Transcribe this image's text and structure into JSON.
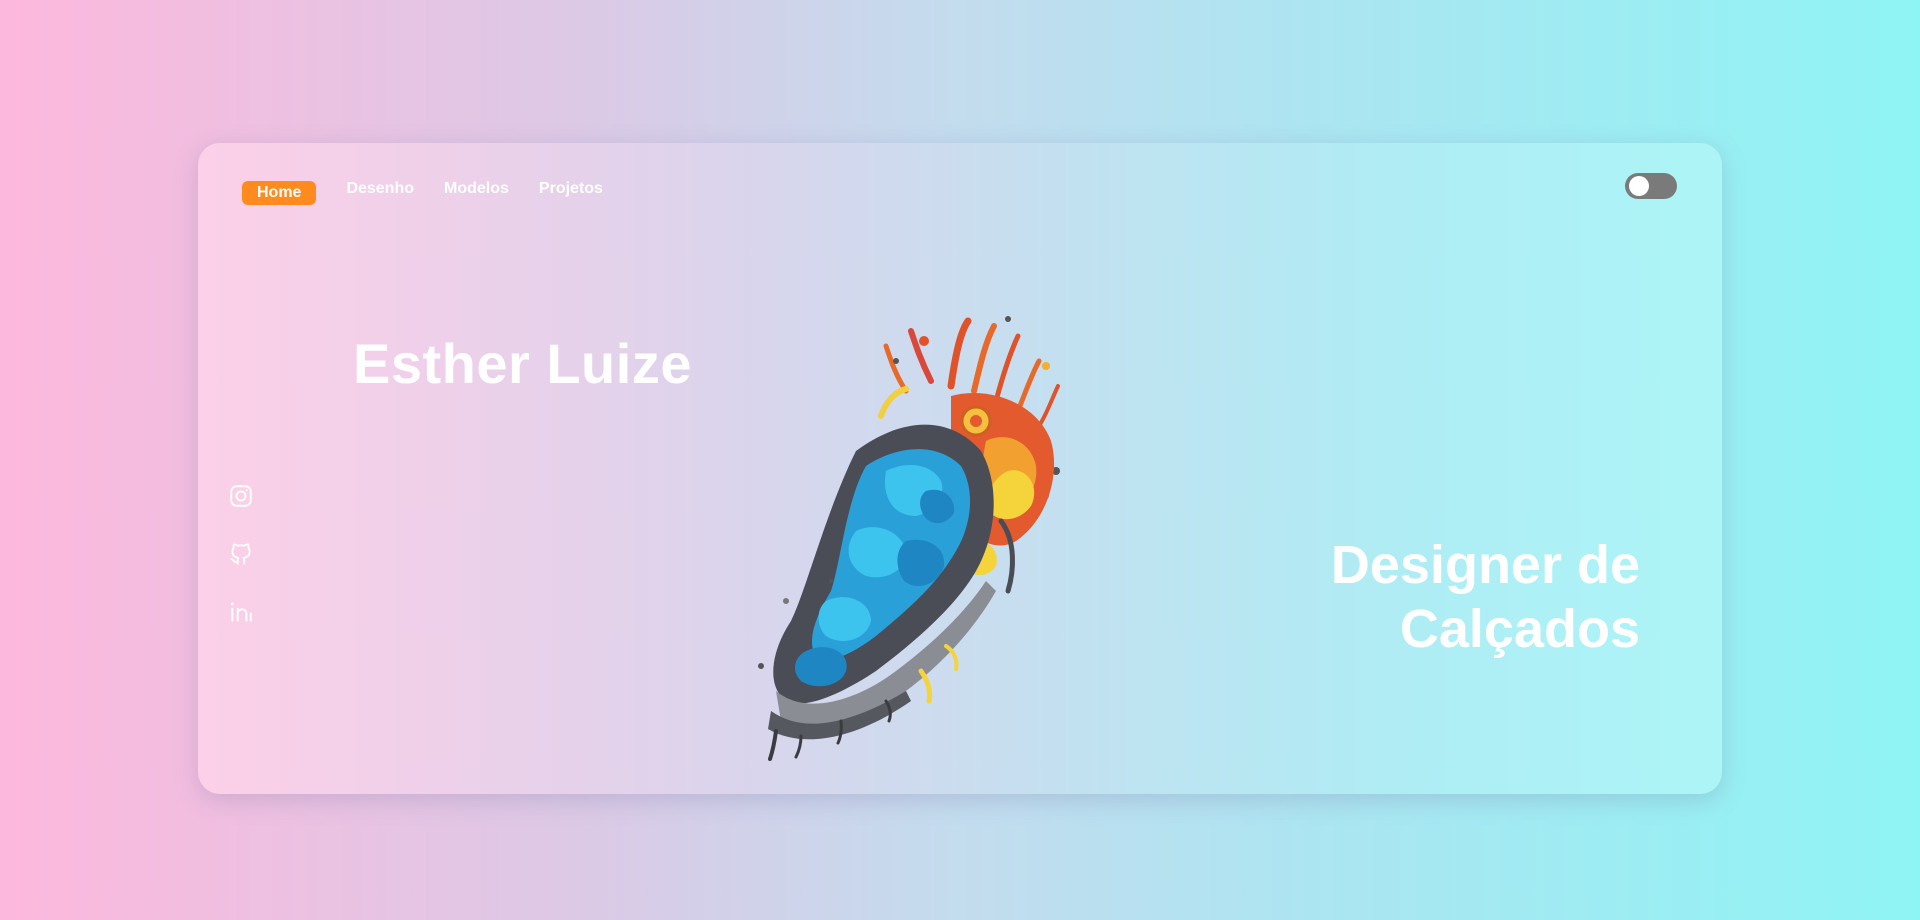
{
  "nav": {
    "items": [
      {
        "label": "Home",
        "active": true
      },
      {
        "label": "Desenho",
        "active": false
      },
      {
        "label": "Modelos",
        "active": false
      },
      {
        "label": "Projetos",
        "active": false
      }
    ]
  },
  "hero": {
    "name": "Esther Luize",
    "subtitle_line1": "Designer de",
    "subtitle_line2": "Calçados"
  },
  "social": {
    "icons": [
      "instagram-icon",
      "github-icon",
      "linkedin-icon"
    ]
  },
  "colors": {
    "accent": "#ff8a1e",
    "toggle": "#7a7a7a"
  }
}
